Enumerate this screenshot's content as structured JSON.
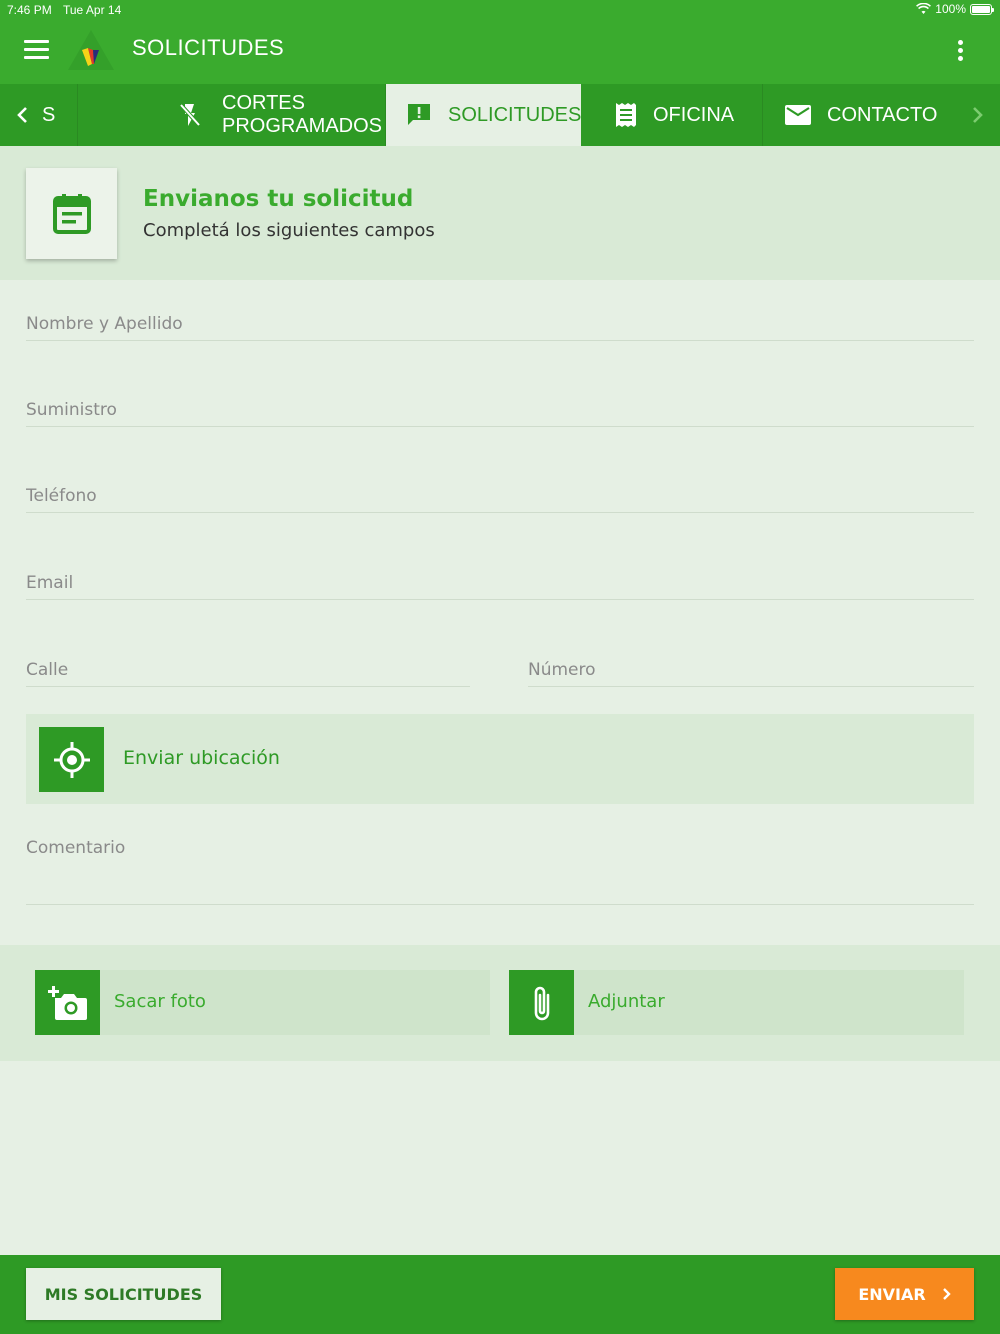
{
  "status": {
    "time": "7:46 PM",
    "date": "Tue Apr 14",
    "battery": "100%"
  },
  "appbar": {
    "title": "SOLICITUDES"
  },
  "tabs": [
    {
      "label": "S",
      "icon": "chevron-left-icon"
    },
    {
      "label": "CORTES PROGRAMADOS",
      "icon": "power-off-icon"
    },
    {
      "label": "SOLICITUDES",
      "icon": "alert-message-icon",
      "active": true
    },
    {
      "label": "OFICINA",
      "icon": "receipt-icon"
    },
    {
      "label": "CONTACTO",
      "icon": "mail-icon"
    }
  ],
  "header": {
    "title": "Envianos tu solicitud",
    "subtitle": "Completá los siguientes campos"
  },
  "form": {
    "nombre": "Nombre y Apellido",
    "suministro": "Suministro",
    "telefono": "Teléfono",
    "email": "Email",
    "calle": "Calle",
    "numero": "Número",
    "ubicacion": "Enviar ubicación",
    "comentario": "Comentario"
  },
  "attach": {
    "foto": "Sacar foto",
    "adjuntar": "Adjuntar"
  },
  "bottom": {
    "mis_solicitudes": "MIS SOLICITUDES",
    "enviar": "ENVIAR"
  },
  "colors": {
    "primary": "#3aab2e",
    "dark": "#2e9a25",
    "accent": "#f7891e",
    "background": "#e6f0e4"
  }
}
